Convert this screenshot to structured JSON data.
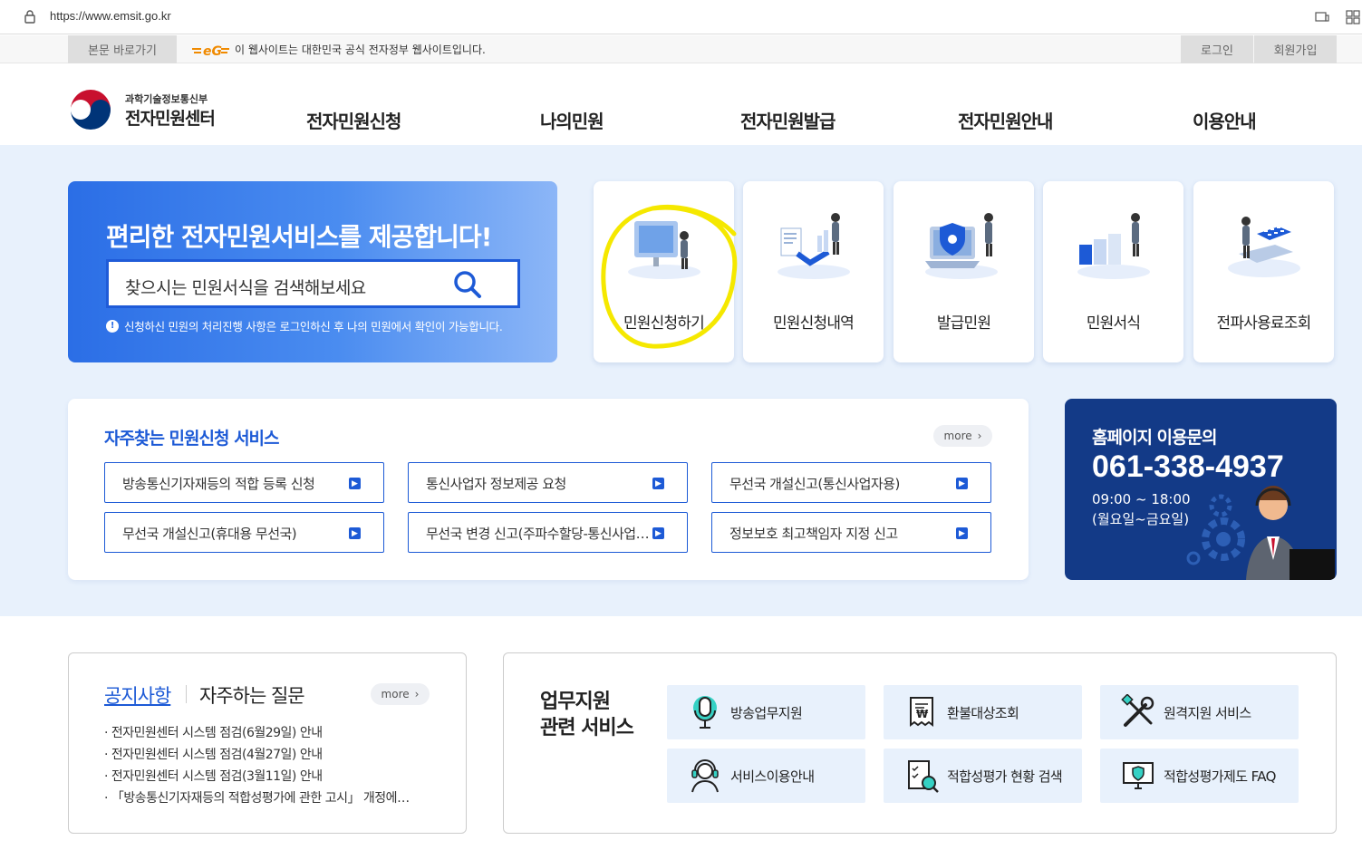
{
  "browser": {
    "url": "https://www.emsit.go.kr"
  },
  "topbar": {
    "skip_label": "본문 바로가기",
    "gov_notice": "이 웹사이트는 대한민국 공식 전자정부 웹사이트입니다.",
    "login_label": "로그인",
    "signup_label": "회원가입"
  },
  "header": {
    "logo_sub": "과학기술정보통신부",
    "logo_main": "전자민원센터",
    "nav": [
      "전자민원신청",
      "나의민원",
      "전자민원발급",
      "전자민원안내",
      "이용안내"
    ]
  },
  "hero": {
    "title": "편리한 전자민원서비스를 제공합니다!",
    "search_placeholder": "찾으시는 민원서식을 검색해보세요",
    "note": "신청하신 민원의 처리진행 사항은 로그인하신 후 나의 민원에서 확인이 가능합니다."
  },
  "quick": [
    {
      "label": "민원신청하기",
      "icon": "monitor-person-icon"
    },
    {
      "label": "민원신청내역",
      "icon": "document-chart-icon"
    },
    {
      "label": "발급민원",
      "icon": "shield-laptop-icon"
    },
    {
      "label": "민원서식",
      "icon": "form-blocks-icon"
    },
    {
      "label": "전파사용료조회",
      "icon": "calculator-icon"
    }
  ],
  "frequent": {
    "title": "자주찾는 민원신청 서비스",
    "more": "more",
    "items": [
      "방송통신기자재등의 적합 등록 신청",
      "통신사업자 정보제공 요청",
      "무선국 개설신고(통신사업자용)",
      "무선국 개설신고(휴대용 무선국)",
      "무선국 변경 신고(주파수할당-통신사업자용)",
      "정보보호 최고책임자 지정 신고"
    ]
  },
  "contact": {
    "title": "홈페이지 이용문의",
    "phone": "061-338-4937",
    "hours": "09:00 ~ 18:00",
    "days": "(월요일~금요일)"
  },
  "notice": {
    "tab_active": "공지사항",
    "tab_other": "자주하는 질문",
    "more": "more",
    "items": [
      "전자민원센터 시스템 점검(6월29일) 안내",
      "전자민원센터 시스템 점검(4월27일) 안내",
      "전자민원센터 시스템 점검(3월11일) 안내",
      "「방송통신기자재등의 적합성평가에 관한 고시」 개정에…"
    ]
  },
  "support": {
    "title_line1": "업무지원",
    "title_line2": "관련 서비스",
    "items": [
      {
        "label": "방송업무지원",
        "icon": "microphone-icon"
      },
      {
        "label": "환불대상조회",
        "icon": "receipt-won-icon"
      },
      {
        "label": "원격지원 서비스",
        "icon": "tools-icon"
      },
      {
        "label": "서비스이용안내",
        "icon": "headset-agent-icon"
      },
      {
        "label": "적합성평가 현황 검색",
        "icon": "checklist-search-icon"
      },
      {
        "label": "적합성평가제도 FAQ",
        "icon": "monitor-shield-icon"
      }
    ]
  },
  "colors": {
    "primary": "#1d5ad6",
    "contact_bg": "#133a87",
    "main_bg": "#e8f1fc",
    "highlight": "#f5e800"
  }
}
